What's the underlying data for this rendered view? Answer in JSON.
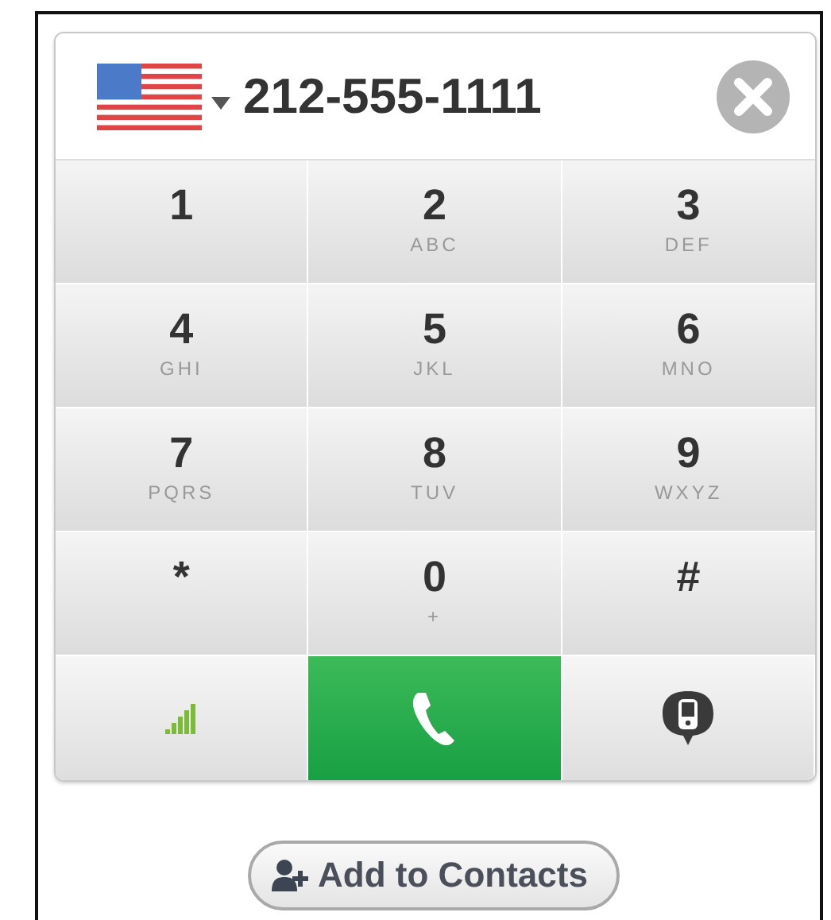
{
  "number_field": {
    "value": "212-555-1111"
  },
  "keys": [
    {
      "digit": "1"
    },
    {
      "digit": "2",
      "letters": "ABC"
    },
    {
      "digit": "3",
      "letters": "DEF"
    },
    {
      "digit": "4",
      "letters": "GHI"
    },
    {
      "digit": "5",
      "letters": "JKL"
    },
    {
      "digit": "6",
      "letters": "MNO"
    },
    {
      "digit": "7",
      "letters": "PQRS"
    },
    {
      "digit": "8",
      "letters": "TUV"
    },
    {
      "digit": "9",
      "letters": "WXYZ"
    },
    {
      "digit": "*"
    },
    {
      "digit": "0",
      "letters": "+"
    },
    {
      "digit": "#"
    }
  ],
  "actions": [
    {
      "kind": "signal"
    },
    {
      "kind": "call"
    },
    {
      "kind": "message"
    }
  ],
  "add_button": {
    "label": "Add to Contacts"
  }
}
